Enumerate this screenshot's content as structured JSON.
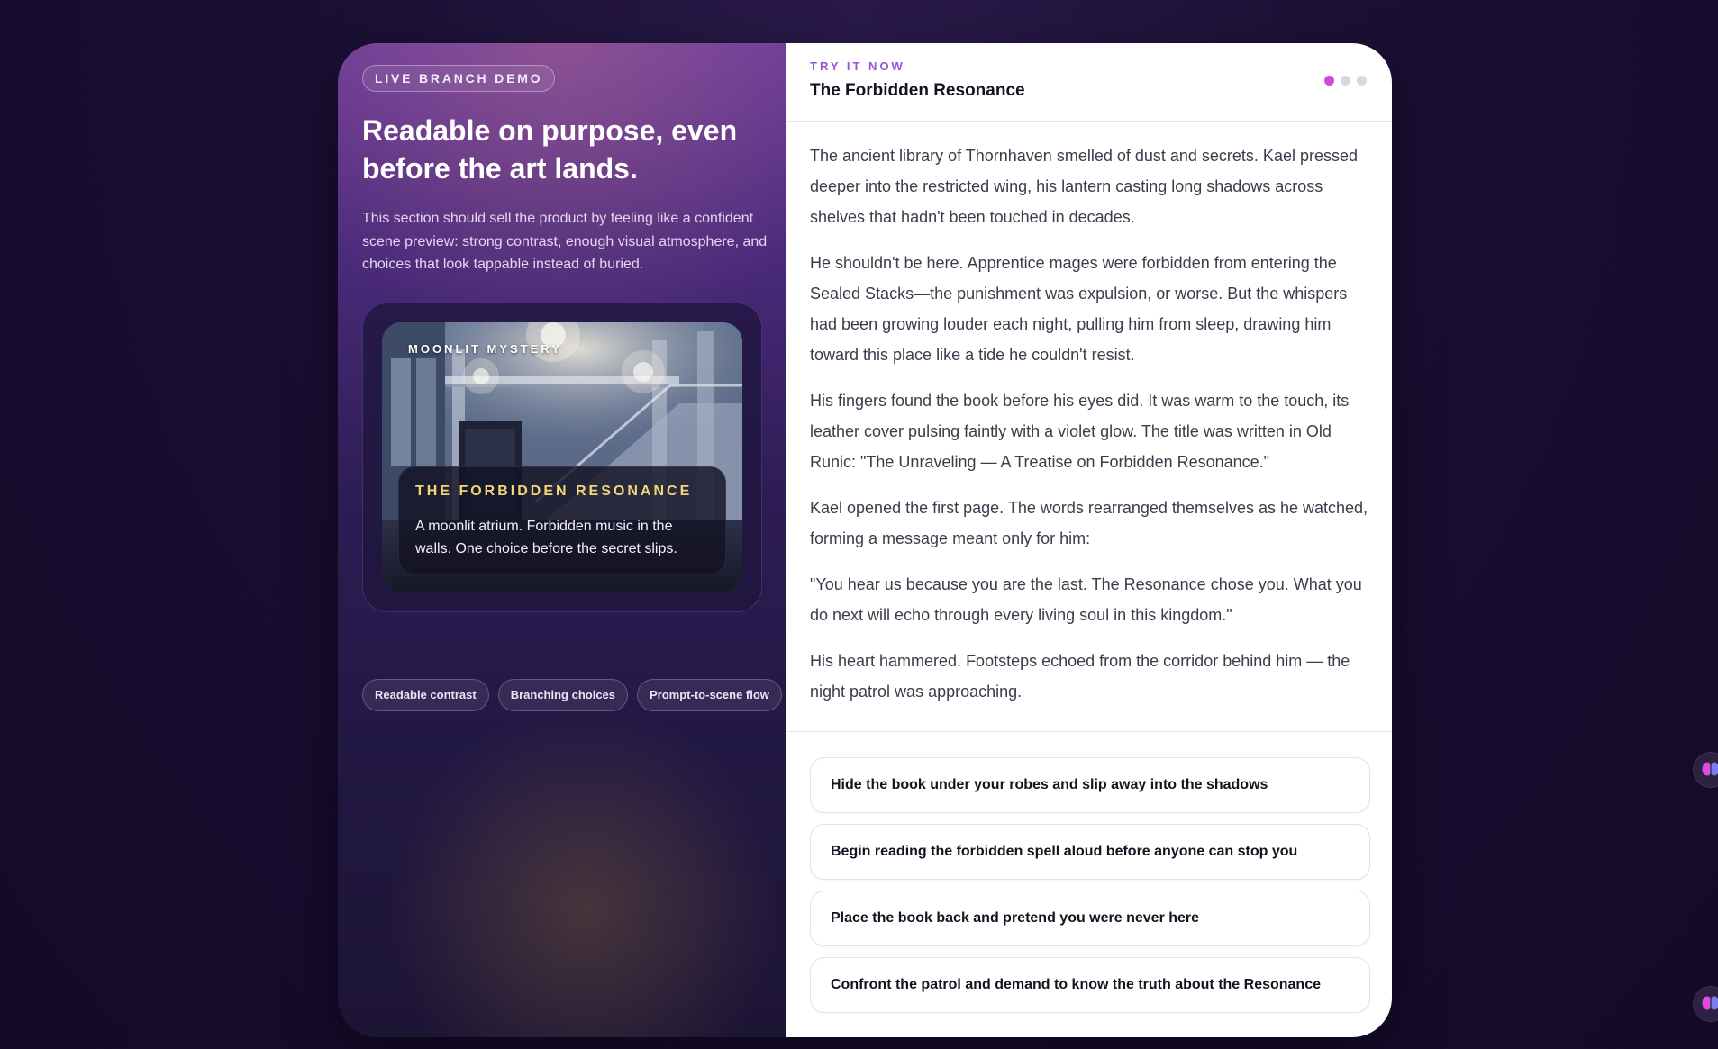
{
  "left": {
    "pill": "LIVE BRANCH DEMO",
    "headline": "Readable on purpose, even before the art lands.",
    "blurb": "This section should sell the product by feeling like a confident scene preview: strong contrast, enough visual atmosphere, and choices that look tappable instead of buried.",
    "scene": {
      "tag": "MOONLIT MYSTERY",
      "title": "THE FORBIDDEN RESONANCE",
      "description": "A moonlit atrium. Forbidden music in the walls. One choice before the secret slips."
    },
    "chips": [
      "Readable contrast",
      "Branching choices",
      "Prompt-to-scene flow"
    ]
  },
  "right": {
    "kicker": "TRY IT NOW",
    "title": "The Forbidden Resonance",
    "progress_dots": 3,
    "active_dot": 1,
    "story": [
      "The ancient library of Thornhaven smelled of dust and secrets. Kael pressed deeper into the restricted wing, his lantern casting long shadows across shelves that hadn't been touched in decades.",
      "He shouldn't be here. Apprentice mages were forbidden from entering the Sealed Stacks—the punishment was expulsion, or worse. But the whispers had been growing louder each night, pulling him from sleep, drawing him toward this place like a tide he couldn't resist.",
      "His fingers found the book before his eyes did. It was warm to the touch, its leather cover pulsing faintly with a violet glow. The title was written in Old Runic: \"The Unraveling — A Treatise on Forbidden Resonance.\"",
      "Kael opened the first page. The words rearranged themselves as he watched, forming a message meant only for him:",
      "\"You hear us because you are the last. The Resonance chose you. What you do next will echo through every living soul in this kingdom.\"",
      "His heart hammered. Footsteps echoed from the corridor behind him — the night patrol was approaching."
    ],
    "choices": [
      "Hide the book under your robes and slip away into the shadows",
      "Begin reading the forbidden spell aloud before anyone can stop you",
      "Place the book back and pretend you were never here",
      "Confront the patrol and demand to know the truth about the Resonance"
    ]
  },
  "colors": {
    "accent": "#d04ad8",
    "kicker": "#9b54d8",
    "scene_title": "#f2d67a"
  },
  "icons": {
    "floating_buttons": [
      "brain-icon",
      "brain-icon"
    ]
  }
}
